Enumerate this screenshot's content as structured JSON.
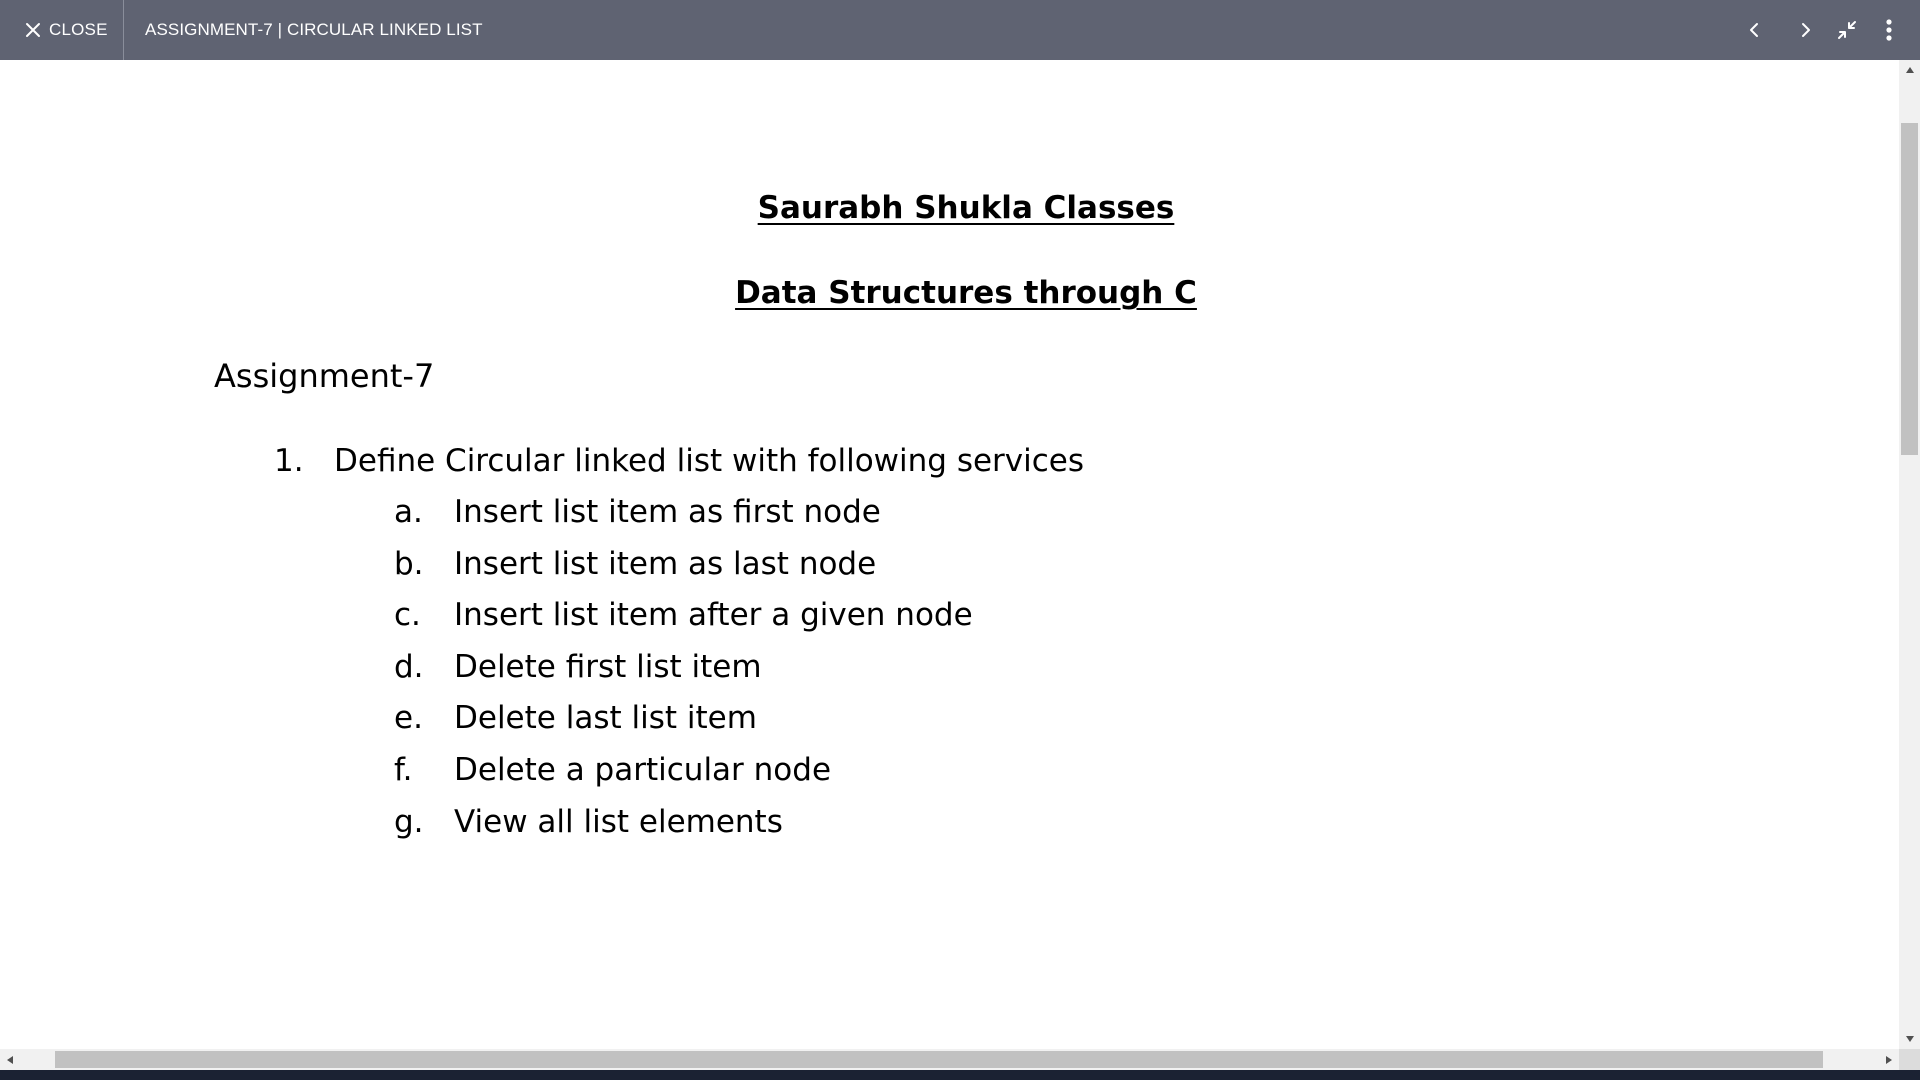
{
  "toolbar": {
    "close_label": "CLOSE",
    "title": "ASSIGNMENT-7 | CIRCULAR LINKED LIST",
    "icons": {
      "close": "close-icon",
      "prev": "chevron-left-icon",
      "next": "chevron-right-icon",
      "collapse": "collapse-icon",
      "more": "more-vertical-icon"
    },
    "background_color": "#5f6372"
  },
  "document": {
    "heading1": "Saurabh Shukla Classes",
    "heading2": "Data Structures through C",
    "assignment_label": "Assignment-7",
    "question": {
      "number": "1.",
      "text": "Define Circular linked list with following services",
      "items": [
        {
          "letter": "a.",
          "text": "Insert list item as first node"
        },
        {
          "letter": "b.",
          "text": "Insert list item as last node"
        },
        {
          "letter": "c.",
          "text": "Insert list item after a given node"
        },
        {
          "letter": "d.",
          "text": "Delete first list item"
        },
        {
          "letter": "e.",
          "text": "Delete last list item"
        },
        {
          "letter": "f.",
          "text": "Delete a particular node"
        },
        {
          "letter": "g.",
          "text": "View all list elements"
        }
      ]
    }
  }
}
